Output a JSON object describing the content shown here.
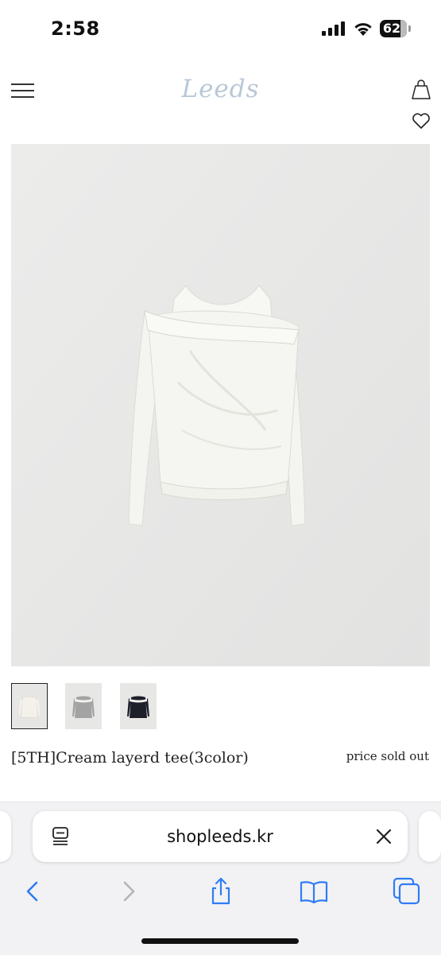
{
  "status_bar": {
    "time": "2:58",
    "battery": "62"
  },
  "header": {
    "logo_text": "Leeds",
    "menu_icon": "hamburger-menu-icon",
    "cart_icon": "shopping-bag-icon",
    "wishlist_icon": "heart-icon"
  },
  "product": {
    "name": "[5TH]Cream layerd tee(3color)",
    "price": "price sold out",
    "thumbnails": [
      {
        "color_name": "cream",
        "color": "#f3f1ea"
      },
      {
        "color_name": "grey",
        "color": "#9d9d9d"
      },
      {
        "color_name": "black",
        "color": "#1d2029"
      }
    ]
  },
  "browser": {
    "url": "shopleeds.kr",
    "accent_color": "#2f7cf6"
  }
}
